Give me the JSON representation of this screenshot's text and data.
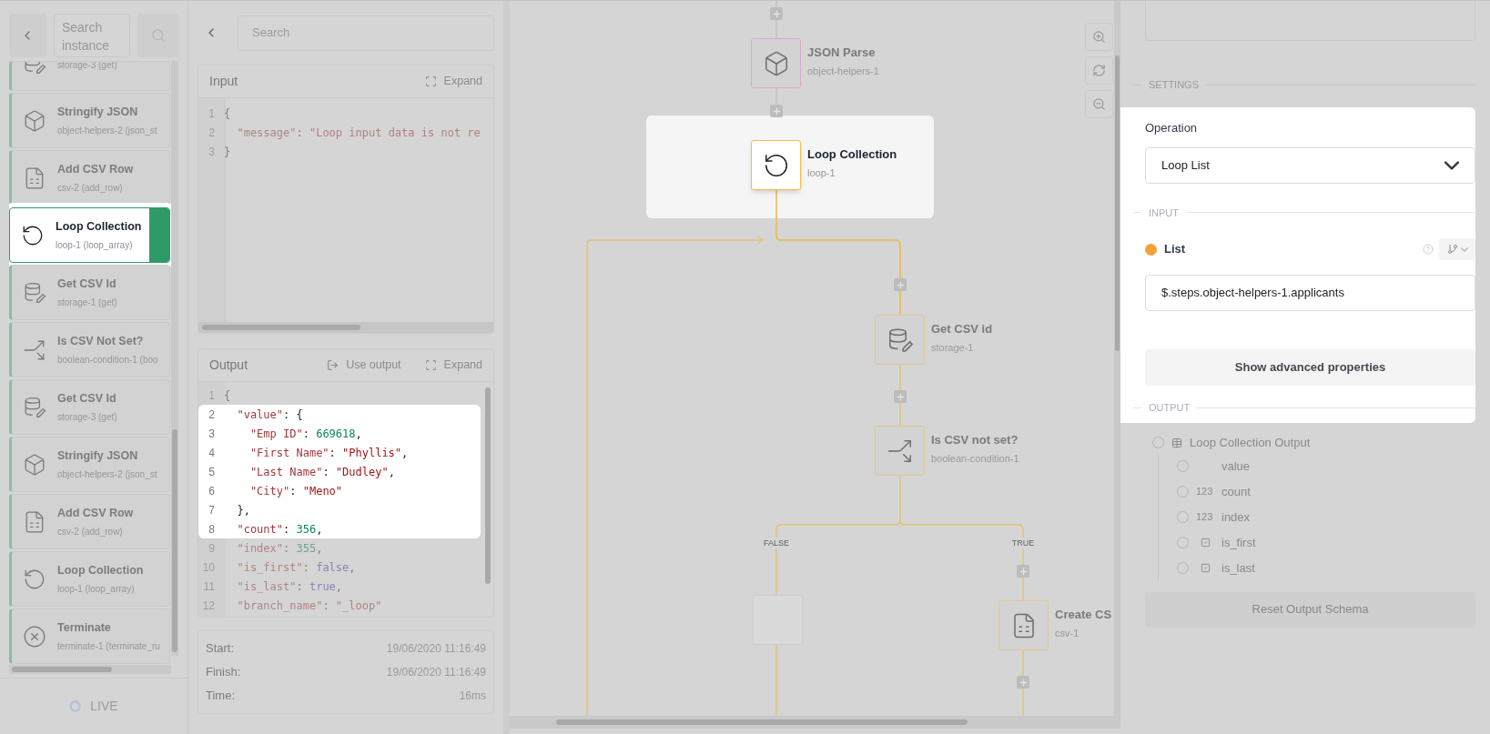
{
  "instance_panel": {
    "search_placeholder": "Search instance",
    "steps": [
      {
        "subtitle": "storage-3 (get)",
        "kind": "database",
        "selected": false
      },
      {
        "title": "Stringify JSON",
        "subtitle": "object-helpers-2 (json_st",
        "kind": "cube",
        "selected": false
      },
      {
        "title": "Add CSV Row",
        "subtitle": "csv-2 (add_row)",
        "kind": "sheet",
        "selected": false
      },
      {
        "title": "Loop Collection",
        "subtitle": "loop-1 (loop_array)",
        "kind": "loop",
        "selected": true
      },
      {
        "title": "Get CSV Id",
        "subtitle": "storage-1 (get)",
        "kind": "database",
        "selected": false
      },
      {
        "title": "Is CSV Not Set?",
        "subtitle": "boolean-condition-1 (boo",
        "kind": "split",
        "selected": false
      },
      {
        "title": "Get CSV Id",
        "subtitle": "storage-3 (get)",
        "kind": "database",
        "selected": false
      },
      {
        "title": "Stringify JSON",
        "subtitle": "object-helpers-2 (json_st",
        "kind": "cube",
        "selected": false
      },
      {
        "title": "Add CSV Row",
        "subtitle": "csv-2 (add_row)",
        "kind": "sheet",
        "selected": false
      },
      {
        "title": "Loop Collection",
        "subtitle": "loop-1 (loop_array)",
        "kind": "loop",
        "selected": false
      },
      {
        "title": "Terminate",
        "subtitle": "terminate-1 (terminate_ru",
        "kind": "terminate",
        "selected": false
      }
    ],
    "live_label": "LIVE"
  },
  "io_panel": {
    "search_placeholder": "Search",
    "input": {
      "title": "Input",
      "expand": "Expand",
      "lines": [
        {
          "n": "1",
          "tokens": [
            {
              "kind": "punct",
              "t": "{"
            }
          ]
        },
        {
          "n": "2",
          "tokens": [
            {
              "kind": "key",
              "t": "  \"message\""
            },
            {
              "kind": "punct",
              "t": ": "
            },
            {
              "kind": "str",
              "t": "\"Loop input data is not re"
            }
          ]
        },
        {
          "n": "3",
          "tokens": [
            {
              "kind": "punct",
              "t": "}"
            }
          ]
        }
      ]
    },
    "output": {
      "title": "Output",
      "use_output": "Use output",
      "expand": "Expand",
      "lines": [
        {
          "n": "1",
          "highlighted": false,
          "tokens": [
            {
              "kind": "punct",
              "t": "{"
            }
          ]
        },
        {
          "n": "2",
          "highlighted": true,
          "tokens": [
            {
              "kind": "key",
              "t": "  \"value\""
            },
            {
              "kind": "punct",
              "t": ": {"
            }
          ]
        },
        {
          "n": "3",
          "highlighted": true,
          "tokens": [
            {
              "kind": "key",
              "t": "    \"Emp ID\""
            },
            {
              "kind": "punct",
              "t": ": "
            },
            {
              "kind": "num",
              "t": "669618"
            },
            {
              "kind": "punct",
              "t": ","
            }
          ]
        },
        {
          "n": "4",
          "highlighted": true,
          "tokens": [
            {
              "kind": "key",
              "t": "    \"First Name\""
            },
            {
              "kind": "punct",
              "t": ": "
            },
            {
              "kind": "str",
              "t": "\"Phyllis\""
            },
            {
              "kind": "punct",
              "t": ","
            }
          ]
        },
        {
          "n": "5",
          "highlighted": true,
          "tokens": [
            {
              "kind": "key",
              "t": "    \"Last Name\""
            },
            {
              "kind": "punct",
              "t": ": "
            },
            {
              "kind": "str",
              "t": "\"Dudley\""
            },
            {
              "kind": "punct",
              "t": ","
            }
          ]
        },
        {
          "n": "6",
          "highlighted": true,
          "tokens": [
            {
              "kind": "key",
              "t": "    \"City\""
            },
            {
              "kind": "punct",
              "t": ": "
            },
            {
              "kind": "str",
              "t": "\"Meno\""
            }
          ]
        },
        {
          "n": "7",
          "highlighted": true,
          "tokens": [
            {
              "kind": "punct",
              "t": "  },"
            }
          ]
        },
        {
          "n": "8",
          "highlighted": true,
          "tokens": [
            {
              "kind": "key",
              "t": "  \"count\""
            },
            {
              "kind": "punct",
              "t": ": "
            },
            {
              "kind": "num",
              "t": "356"
            },
            {
              "kind": "punct",
              "t": ","
            }
          ]
        },
        {
          "n": "9",
          "highlighted": false,
          "tokens": [
            {
              "kind": "key",
              "t": "  \"index\""
            },
            {
              "kind": "punct",
              "t": ": "
            },
            {
              "kind": "num",
              "t": "355"
            },
            {
              "kind": "punct",
              "t": ","
            }
          ]
        },
        {
          "n": "10",
          "highlighted": false,
          "tokens": [
            {
              "kind": "key",
              "t": "  \"is_first\""
            },
            {
              "kind": "punct",
              "t": ": "
            },
            {
              "kind": "bool",
              "t": "false"
            },
            {
              "kind": "punct",
              "t": ","
            }
          ]
        },
        {
          "n": "11",
          "highlighted": false,
          "tokens": [
            {
              "kind": "key",
              "t": "  \"is_last\""
            },
            {
              "kind": "punct",
              "t": ": "
            },
            {
              "kind": "bool",
              "t": "true"
            },
            {
              "kind": "punct",
              "t": ","
            }
          ]
        },
        {
          "n": "12",
          "highlighted": false,
          "tokens": [
            {
              "kind": "key",
              "t": "  \"branch_name\""
            },
            {
              "kind": "punct",
              "t": ": "
            },
            {
              "kind": "str",
              "t": "\"_loop\""
            }
          ]
        }
      ]
    },
    "timing": [
      {
        "label": "Start:",
        "value": "19/06/2020 11:16:49"
      },
      {
        "label": "Finish:",
        "value": "19/06/2020 11:16:49"
      },
      {
        "label": "Time:",
        "value": "16ms"
      }
    ]
  },
  "canvas": {
    "nodes": [
      {
        "title": "JSON Parse",
        "subtitle": "object-helpers-1",
        "kind": "cube",
        "selected": false
      },
      {
        "title": "Loop Collection",
        "subtitle": "loop-1",
        "kind": "loop",
        "selected": true
      },
      {
        "title": "Get CSV id",
        "subtitle": "storage-1",
        "kind": "database",
        "selected": false
      },
      {
        "title": "Is CSV not set?",
        "subtitle": "boolean-condition-1",
        "kind": "split",
        "selected": false
      },
      {
        "kind": "empty",
        "selected": false
      },
      {
        "title": "Create CS",
        "subtitle": "csv-1",
        "kind": "sheet",
        "selected": false
      }
    ],
    "branch_labels": [
      "FALSE",
      "TRUE"
    ]
  },
  "settings": {
    "section": "SETTINGS",
    "operation_label": "Operation",
    "operation_value": "Loop List",
    "input_section": "INPUT",
    "list_label": "List",
    "list_value": "$.steps.object-helpers-1.applicants",
    "advanced_button": "Show advanced properties",
    "output_section": "OUTPUT",
    "output_tree": {
      "label": "Loop Collection Output",
      "selected": false,
      "children": [
        {
          "kind": "any",
          "label": "value",
          "selected": false
        },
        {
          "kind": "number",
          "type_label": "123",
          "label": "count",
          "selected": false
        },
        {
          "kind": "number",
          "type_label": "123",
          "label": "index",
          "selected": false
        },
        {
          "kind": "boolean",
          "label": "is_first",
          "selected": false
        },
        {
          "kind": "boolean",
          "label": "is_last",
          "selected": false
        }
      ]
    },
    "reset_button": "Reset Output Schema"
  }
}
